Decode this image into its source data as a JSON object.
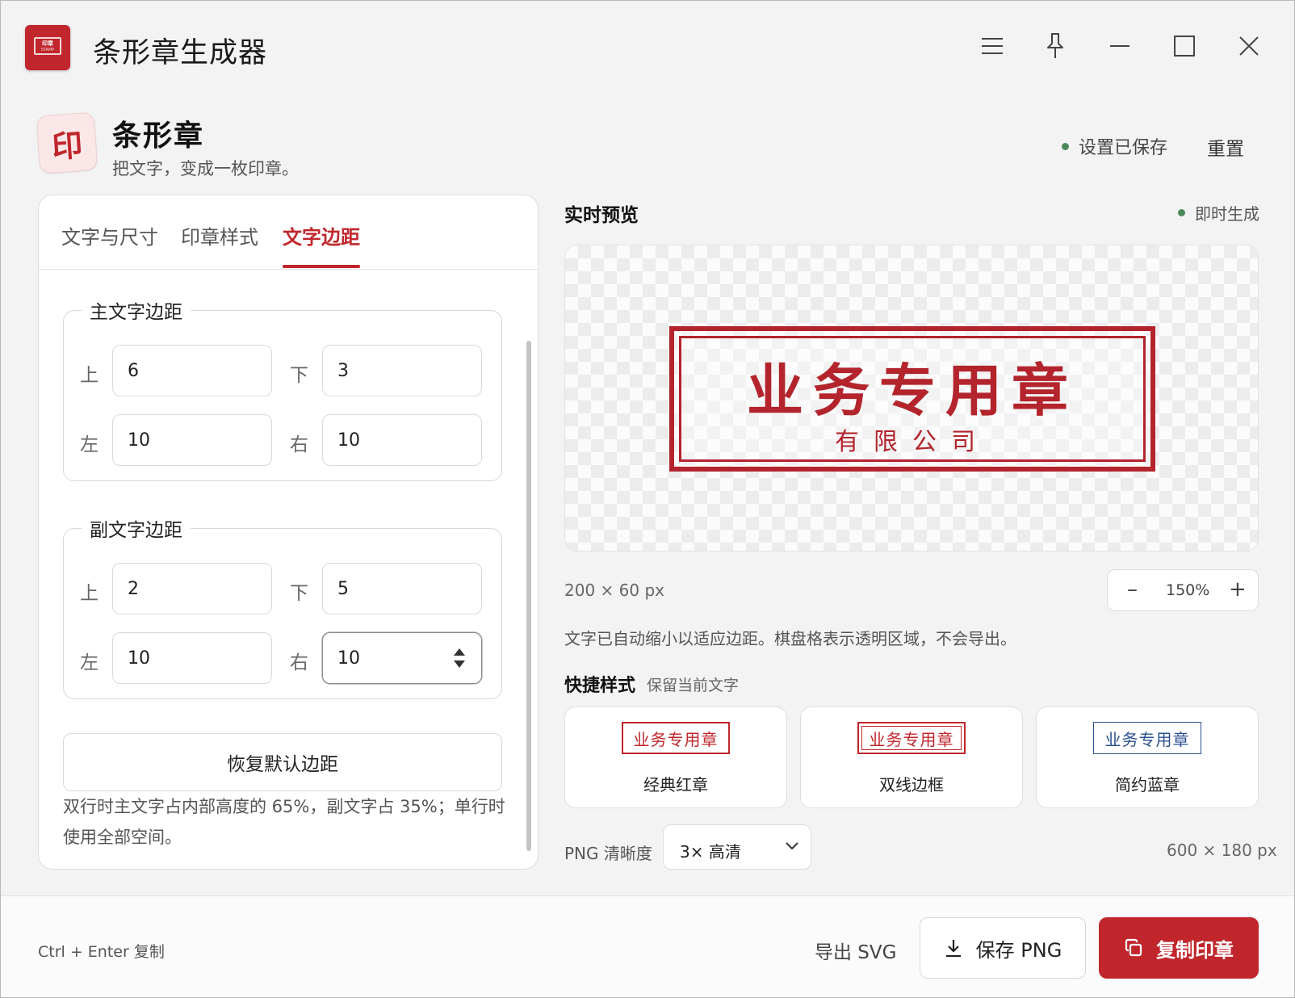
{
  "window": {
    "title": "条形章生成器",
    "app_icon_text": "印章",
    "app_icon_subtext": "STAMP"
  },
  "header": {
    "logo_glyph": "印",
    "title": "条形章",
    "subtitle": "把文字，变成一枚印章。",
    "saved_status": "设置已保存",
    "reset_label": "重置"
  },
  "tabs": [
    {
      "label": "文字与尺寸",
      "active": false
    },
    {
      "label": "印章样式",
      "active": false
    },
    {
      "label": "文字边距",
      "active": true
    }
  ],
  "main_padding": {
    "legend": "主文字边距",
    "top_label": "上",
    "top": "6",
    "bottom_label": "下",
    "bottom": "3",
    "left_label": "左",
    "left": "10",
    "right_label": "右",
    "right": "10"
  },
  "sub_padding": {
    "legend": "副文字边距",
    "top_label": "上",
    "top": "2",
    "bottom_label": "下",
    "bottom": "5",
    "left_label": "左",
    "left": "10",
    "right_label": "右",
    "right": "10"
  },
  "restore_button": "恢复默认边距",
  "padding_note": "双行时主文字占内部高度的 65%，副文字占 35%；单行时使用全部空间。",
  "preview": {
    "title": "实时预览",
    "instant_label": "即时生成",
    "stamp_main_text": "业务专用章",
    "stamp_sub_text": "有限公司",
    "stamp_color": "#b3242c",
    "size_label": "200 × 60 px",
    "zoom_value": "150%",
    "zoom_minus": "–",
    "zoom_plus": "+",
    "auto_note": "文字已自动缩小以适应边距。棋盘格表示透明区域，不会导出。"
  },
  "quick_styles": {
    "title": "快捷样式",
    "hint": "保留当前文字",
    "items": [
      {
        "preview_text": "业务专用章",
        "label": "经典红章",
        "color": "#c0262c"
      },
      {
        "preview_text": "业务专用章",
        "label": "双线边框",
        "color": "#c0262c"
      },
      {
        "preview_text": "业务专用章",
        "label": "简约蓝章",
        "color": "#2b4f8f"
      }
    ]
  },
  "export": {
    "png_quality_label": "PNG 清晰度",
    "png_quality_value": "3× 高清",
    "output_size": "600 × 180 px"
  },
  "footer": {
    "shortcut_hint": "Ctrl + Enter 复制",
    "export_svg": "导出 SVG",
    "save_png": "保存 PNG",
    "copy_stamp": "复制印章"
  },
  "colors": {
    "accent": "#c0262c",
    "status_dot": "#4b8a5a",
    "blue_stamp": "#2b4f8f"
  },
  "icons": [
    "menu-icon",
    "pin-icon",
    "minimize-icon",
    "maximize-icon",
    "close-icon",
    "download-icon",
    "copy-icon",
    "chevron-down-icon"
  ]
}
